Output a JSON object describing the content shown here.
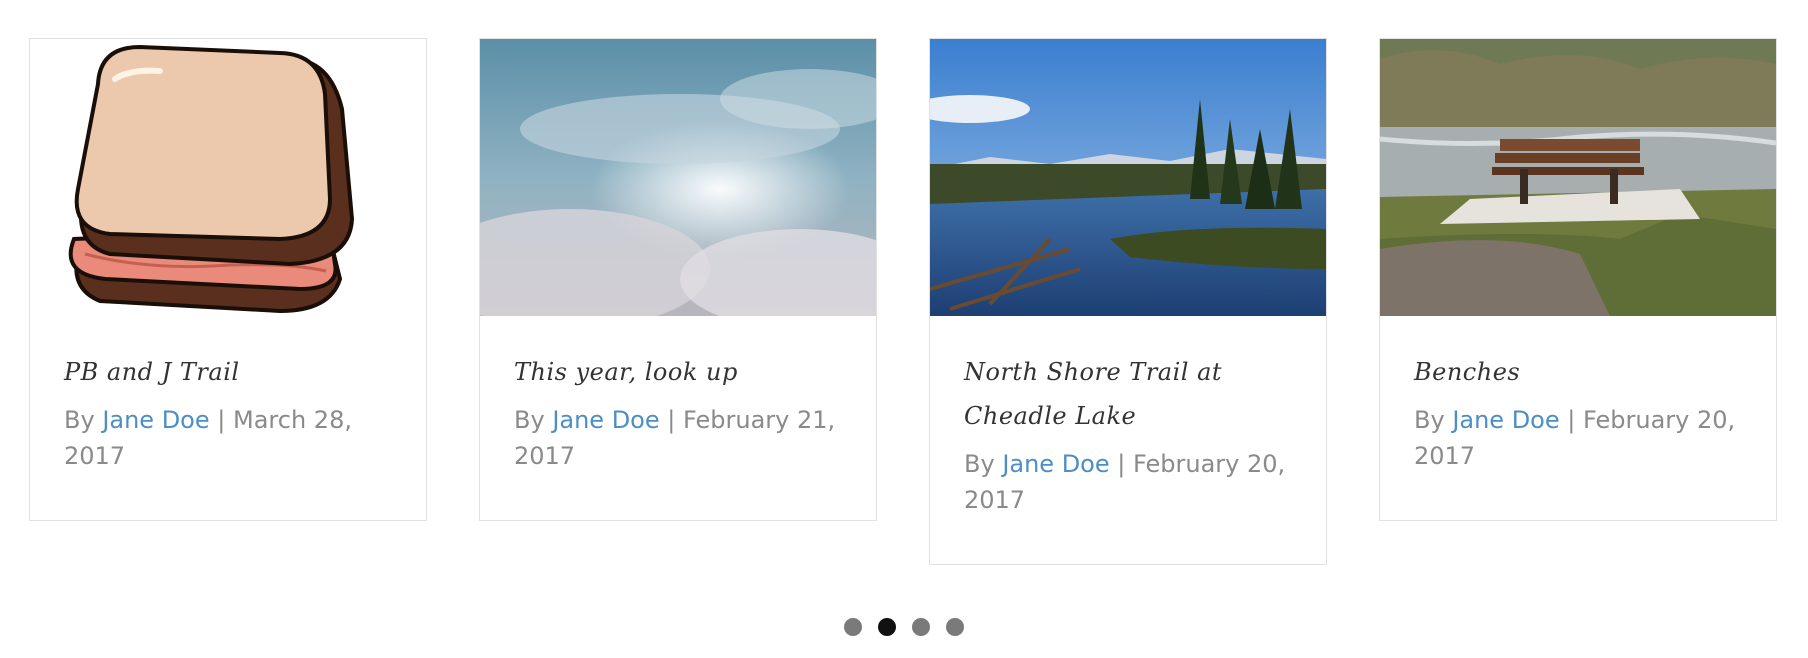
{
  "posts": [
    {
      "title": "PB and J Trail",
      "by": "By",
      "author": "Jane Doe",
      "separator": "|",
      "date": "March 28, 2017",
      "image": "sandwich-illustration"
    },
    {
      "title": "This year, look up",
      "by": "By",
      "author": "Jane Doe",
      "separator": "|",
      "date": "February 21, 2017",
      "image": "cloudy-sky-photo"
    },
    {
      "title": "North Shore Trail at Cheadle Lake",
      "by": "By",
      "author": "Jane Doe",
      "separator": "|",
      "date": "February 20, 2017",
      "image": "lake-photo"
    },
    {
      "title": "Benches",
      "by": "By",
      "author": "Jane Doe",
      "separator": "|",
      "date": "February 20, 2017",
      "image": "bench-by-river-photo"
    }
  ],
  "pagination": {
    "count": 4,
    "active_index": 1
  },
  "colors": {
    "link": "#4d8ec4",
    "meta_text": "#8a8a8a",
    "card_border": "#e1e1e1",
    "dot_inactive": "#7a7a7a",
    "dot_active": "#111111"
  }
}
